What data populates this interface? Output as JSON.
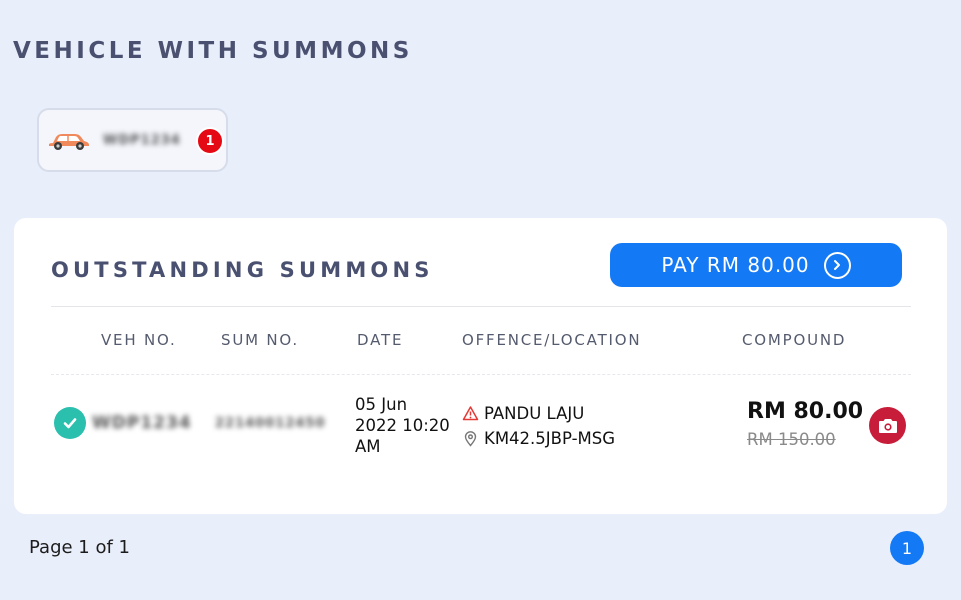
{
  "page": {
    "title": "VEHICLE WITH SUMMONS"
  },
  "vehicle_chip": {
    "plate": "WDP1234",
    "badge_count": "1",
    "icon": "car-icon",
    "icon_color": "#f08a5d"
  },
  "summons_card": {
    "title": "OUTSTANDING SUMMONS",
    "pay_button_label": "PAY RM 80.00",
    "columns": {
      "veh_no": "VEH NO.",
      "sum_no": "SUM NO.",
      "date": "DATE",
      "offence_location": "OFFENCE/LOCATION",
      "compound": "COMPOUND"
    },
    "rows": [
      {
        "status_icon": "check-circle-icon",
        "veh_no": "WDP1234",
        "sum_no": "22140012450",
        "date_line1": "05 Jun",
        "date_line2": "2022 10:20",
        "date_line3": "AM",
        "offence": "PANDU LAJU",
        "location": "KM42.5JBP-MSG",
        "compound": "RM 80.00",
        "original_compound": "RM 150.00"
      }
    ]
  },
  "pagination": {
    "label": "Page 1 of 1",
    "current_page": "1"
  },
  "colors": {
    "background": "#e9eefb",
    "accent": "#1479f5",
    "badge": "#e50914",
    "check": "#2bbfae",
    "camera": "#c81d3a"
  }
}
